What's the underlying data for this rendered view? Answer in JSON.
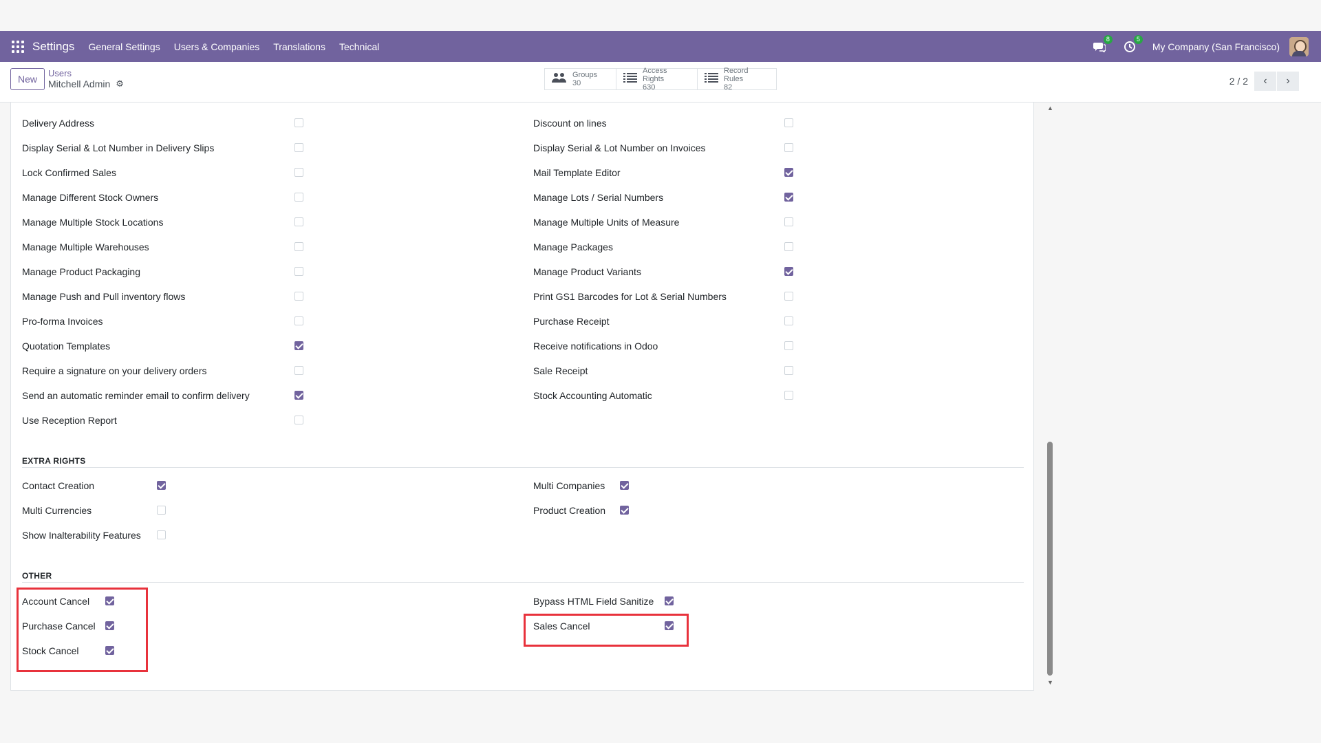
{
  "navbar": {
    "app_name": "Settings",
    "menus": [
      "General Settings",
      "Users & Companies",
      "Translations",
      "Technical"
    ],
    "messages_count": "8",
    "activities_count": "5",
    "company": "My Company (San Francisco)"
  },
  "controlpanel": {
    "new_label": "New",
    "breadcrumb": "Users",
    "record_title": "Mitchell Admin",
    "smart_buttons": [
      {
        "label": "Groups",
        "value": "30",
        "icon": "users-icon"
      },
      {
        "label": "Access Rights",
        "value": "630",
        "icon": "list-icon"
      },
      {
        "label": "Record Rules",
        "value": "82",
        "icon": "list-icon"
      }
    ],
    "pager": "2 / 2"
  },
  "technical_left": [
    {
      "label": "Delivery Address",
      "checked": false
    },
    {
      "label": "Display Serial & Lot Number in Delivery Slips",
      "checked": false
    },
    {
      "label": "Lock Confirmed Sales",
      "checked": false
    },
    {
      "label": "Manage Different Stock Owners",
      "checked": false
    },
    {
      "label": "Manage Multiple Stock Locations",
      "checked": false
    },
    {
      "label": "Manage Multiple Warehouses",
      "checked": false
    },
    {
      "label": "Manage Product Packaging",
      "checked": false
    },
    {
      "label": "Manage Push and Pull inventory flows",
      "checked": false
    },
    {
      "label": "Pro-forma Invoices",
      "checked": false
    },
    {
      "label": "Quotation Templates",
      "checked": true
    },
    {
      "label": "Require a signature on your delivery orders",
      "checked": false
    },
    {
      "label": "Send an automatic reminder email to confirm delivery",
      "checked": true
    },
    {
      "label": "Use Reception Report",
      "checked": false
    }
  ],
  "technical_right": [
    {
      "label": "Discount on lines",
      "checked": false
    },
    {
      "label": "Display Serial & Lot Number on Invoices",
      "checked": false
    },
    {
      "label": "Mail Template Editor",
      "checked": true
    },
    {
      "label": "Manage Lots / Serial Numbers",
      "checked": true
    },
    {
      "label": "Manage Multiple Units of Measure",
      "checked": false
    },
    {
      "label": "Manage Packages",
      "checked": false
    },
    {
      "label": "Manage Product Variants",
      "checked": true
    },
    {
      "label": "Print GS1 Barcodes for Lot & Serial Numbers",
      "checked": false
    },
    {
      "label": "Purchase Receipt",
      "checked": false
    },
    {
      "label": "Receive notifications in Odoo",
      "checked": false
    },
    {
      "label": "Sale Receipt",
      "checked": false
    },
    {
      "label": "Stock Accounting Automatic",
      "checked": false
    }
  ],
  "extra_rights": {
    "title": "EXTRA RIGHTS",
    "left": [
      {
        "label": "Contact Creation",
        "checked": true
      },
      {
        "label": "Multi Currencies",
        "checked": false
      },
      {
        "label": "Show Inalterability Features",
        "checked": false
      }
    ],
    "right": [
      {
        "label": "Multi Companies",
        "checked": true
      },
      {
        "label": "Product Creation",
        "checked": true
      }
    ]
  },
  "other": {
    "title": "OTHER",
    "left": [
      {
        "label": "Account Cancel",
        "checked": true
      },
      {
        "label": "Purchase Cancel",
        "checked": true
      },
      {
        "label": "Stock Cancel",
        "checked": true
      }
    ],
    "right": [
      {
        "label": "Bypass HTML Field Sanitize",
        "checked": true
      },
      {
        "label": "Sales Cancel",
        "checked": true
      }
    ]
  },
  "colors": {
    "brand": "#71639e",
    "highlight": "#e8323c",
    "badge": "#28a745"
  }
}
